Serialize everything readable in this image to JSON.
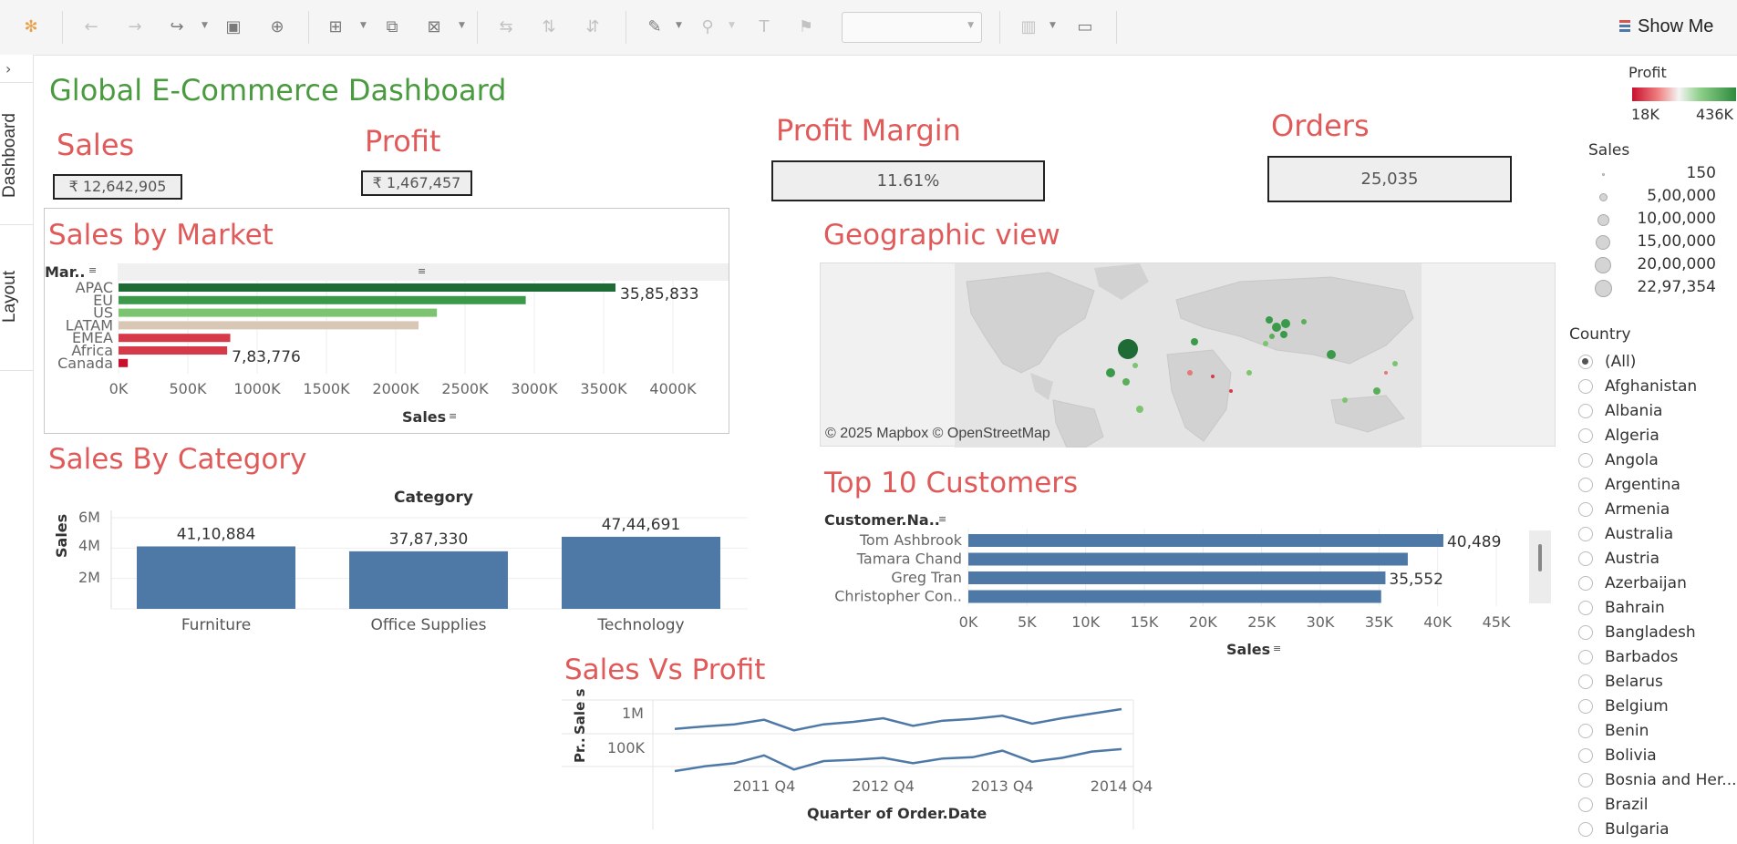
{
  "toolbar": {
    "show_me_label": "Show Me"
  },
  "rail": {
    "tabs": [
      "Dashboard",
      "Layout"
    ]
  },
  "dashboard": {
    "title": "Global E-Commerce Dashboard",
    "title_color": "#4a9a3f",
    "accent_red": "#e05a5a"
  },
  "kpis": {
    "sales": {
      "label": "Sales",
      "value": "₹ 12,642,905"
    },
    "profit": {
      "label": "Profit",
      "value": "₹ 1,467,457"
    },
    "margin": {
      "label": "Profit Margin",
      "value": "11.61%"
    },
    "orders": {
      "label": "Orders",
      "value": "25,035"
    }
  },
  "sales_by_market": {
    "title": "Sales by Market",
    "row_header": "Mar..",
    "value_labels": [
      "35,85,833",
      "7,83,776"
    ],
    "ticks": [
      "0K",
      "500K",
      "1000K",
      "1500K",
      "2000K",
      "2500K",
      "3000K",
      "3500K",
      "4000K"
    ],
    "axis_title": "Sales"
  },
  "sales_by_category": {
    "title": "Sales By Category",
    "header": "Category",
    "y_axis_title": "Sales",
    "y_ticks": [
      "6M",
      "4M",
      "2M"
    ]
  },
  "geo": {
    "title": "Geographic view",
    "credit": "© 2025 Mapbox © OpenStreetMap"
  },
  "top_customers": {
    "title": "Top 10 Customers",
    "row_header": "Customer.Na..",
    "value_labels": [
      "40,489",
      "35,552"
    ],
    "ticks": [
      "0K",
      "5K",
      "10K",
      "15K",
      "20K",
      "25K",
      "30K",
      "35K",
      "40K",
      "45K"
    ],
    "axis_title": "Sales"
  },
  "sales_vs_profit": {
    "title": "Sales Vs Profit",
    "y_label_top": "Sale s",
    "y_label_bottom": "Pr..",
    "y_tick_top": "1M",
    "y_tick_bottom": "100K",
    "x_ticks": [
      "2011 Q4",
      "2012 Q4",
      "2013 Q4",
      "2014 Q4"
    ],
    "x_axis_title": "Quarter of Order.Date"
  },
  "legend": {
    "profit": {
      "title": "Profit",
      "min": "18K",
      "max": "436K",
      "color_low": "#c8102e",
      "color_high": "#2e8b3e"
    },
    "sales": {
      "title": "Sales",
      "sizes": [
        "150",
        "5,00,000",
        "10,00,000",
        "15,00,000",
        "20,00,000",
        "22,97,354"
      ]
    }
  },
  "country_filter": {
    "title": "Country",
    "selected": "(All)",
    "options": [
      "(All)",
      "Afghanistan",
      "Albania",
      "Algeria",
      "Angola",
      "Argentina",
      "Armenia",
      "Australia",
      "Austria",
      "Azerbaijan",
      "Bahrain",
      "Bangladesh",
      "Barbados",
      "Belarus",
      "Belgium",
      "Benin",
      "Bolivia",
      "Bosnia and Her...",
      "Brazil",
      "Bulgaria"
    ]
  },
  "chart_data": [
    {
      "type": "bar",
      "title": "Sales by Market",
      "orientation": "horizontal",
      "categories": [
        "APAC",
        "EU",
        "US",
        "LATAM",
        "EMEA",
        "Africa",
        "Canada"
      ],
      "values": [
        3585833,
        2938089,
        2297201,
        2164605,
        806161,
        783776,
        66929
      ],
      "profit_color": [
        "#1e6b35",
        "#3a9a4a",
        "#7cc46f",
        "#d9c7b5",
        "#d63a48",
        "#d63a48",
        "#c8102e"
      ],
      "xlabel": "Sales",
      "xlim": [
        0,
        4000000
      ]
    },
    {
      "type": "bar",
      "title": "Sales By Category",
      "categories": [
        "Furniture",
        "Office Supplies",
        "Technology"
      ],
      "values": [
        4110884,
        3787330,
        4744691
      ],
      "value_labels": [
        "41,10,884",
        "37,87,330",
        "47,44,691"
      ],
      "ylabel": "Sales",
      "ylim": [
        0,
        6000000
      ],
      "color": "#4e79a7"
    },
    {
      "type": "bar",
      "title": "Top 10 Customers",
      "orientation": "horizontal",
      "categories": [
        "Tom Ashbrook",
        "Tamara Chand",
        "Greg Tran",
        "Christopher Con.."
      ],
      "values": [
        40489,
        37457,
        35552,
        35187
      ],
      "xlabel": "Sales",
      "xlim": [
        0,
        45000
      ],
      "color": "#4e79a7"
    },
    {
      "type": "line",
      "title": "Sales Vs Profit",
      "x": [
        "2011 Q1",
        "2011 Q2",
        "2011 Q3",
        "2011 Q4",
        "2012 Q1",
        "2012 Q2",
        "2012 Q3",
        "2012 Q4",
        "2013 Q1",
        "2013 Q2",
        "2013 Q3",
        "2013 Q4",
        "2014 Q1",
        "2014 Q2",
        "2014 Q3",
        "2014 Q4"
      ],
      "series": [
        {
          "name": "Sales",
          "values": [
            0.55,
            0.63,
            0.7,
            0.85,
            0.5,
            0.7,
            0.78,
            0.9,
            0.65,
            0.82,
            0.88,
            0.98,
            0.72,
            0.9,
            1.05,
            1.2
          ]
        },
        {
          "name": "Profit",
          "values": [
            0.3,
            0.45,
            0.55,
            0.8,
            0.35,
            0.62,
            0.66,
            0.72,
            0.55,
            0.7,
            0.74,
            0.95,
            0.6,
            0.72,
            0.92,
            1.0
          ]
        }
      ],
      "xlabel": "Quarter of Order.Date",
      "color": "#4e79a7"
    }
  ]
}
